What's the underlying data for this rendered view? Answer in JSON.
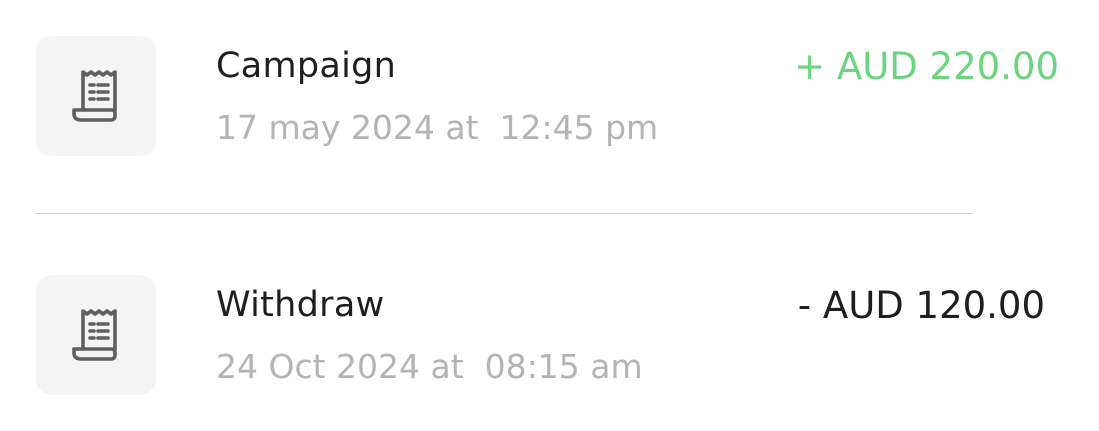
{
  "transactions": [
    {
      "icon": "receipt-icon",
      "title": "Campaign",
      "date": "17 may 2024 at  12:45 pm",
      "amount": "+ AUD 220.00",
      "amount_color": "#6ad47e"
    },
    {
      "icon": "receipt-icon",
      "title": "Withdraw",
      "date": "24 Oct 2024 at  08:15 am",
      "amount": "- AUD 120.00",
      "amount_color": "#1e1e1e"
    }
  ],
  "colors": {
    "icon_tile_bg": "#f4f4f4",
    "icon_stroke": "#5f5f5f",
    "secondary_text": "#b4b4b4",
    "divider": "#cfcfcf"
  }
}
